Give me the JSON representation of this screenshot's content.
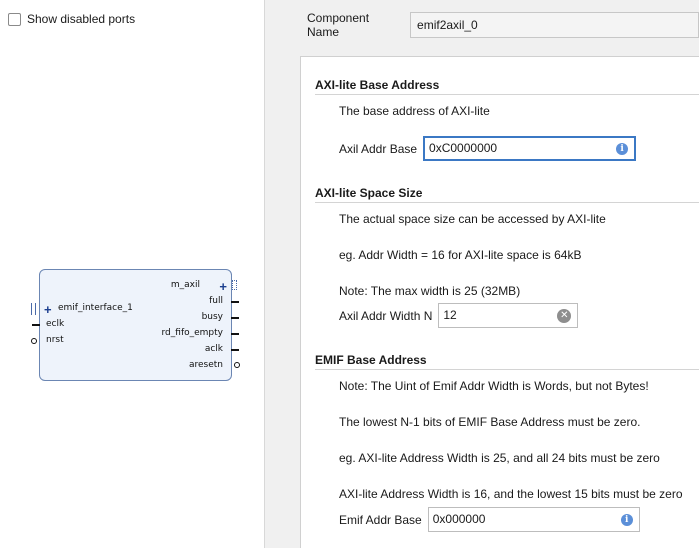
{
  "left_panel": {
    "show_disabled_label": "Show disabled ports",
    "ip_block": {
      "left_ports": {
        "emif_interface": "emif_interface_1",
        "eclk": "eclk",
        "nrst": "nrst"
      },
      "right_ports": {
        "m_axil": "m_axil",
        "full": "full",
        "busy": "busy",
        "rd_fifo_empty": "rd_fifo_empty",
        "aclk": "aclk",
        "aresetn": "aresetn"
      }
    }
  },
  "component": {
    "label": "Component Name",
    "value": "emif2axil_0"
  },
  "sections": {
    "axil_base": {
      "title": "AXI-lite Base Address",
      "desc": "The base address of AXI-lite",
      "field_label": "Axil Addr Base",
      "field_value": "0xC0000000"
    },
    "axil_space": {
      "title": "AXI-lite Space Size",
      "desc1": "The actual space size can be accessed by AXI-lite",
      "desc2": "eg. Addr Width = 16 for AXI-lite space is 64kB",
      "desc3": "Note: The max width is 25 (32MB)",
      "field_label": "Axil Addr Width N",
      "field_value": "12"
    },
    "emif_base": {
      "title": "EMIF Base Address",
      "desc1": "Note: The Uint of Emif Addr Width is Words, but not Bytes!",
      "desc2": "The lowest N-1 bits of EMIF Base Address must be zero.",
      "desc3": "eg. AXI-lite Address Width is 25, and all 24 bits must be zero",
      "desc4": "AXI-lite Address Width is 16, and the lowest 15 bits must be zero",
      "field_label": "Emif Addr Base",
      "field_value": "0x000000"
    }
  },
  "icons": {
    "info": "i",
    "clear": "✕"
  }
}
